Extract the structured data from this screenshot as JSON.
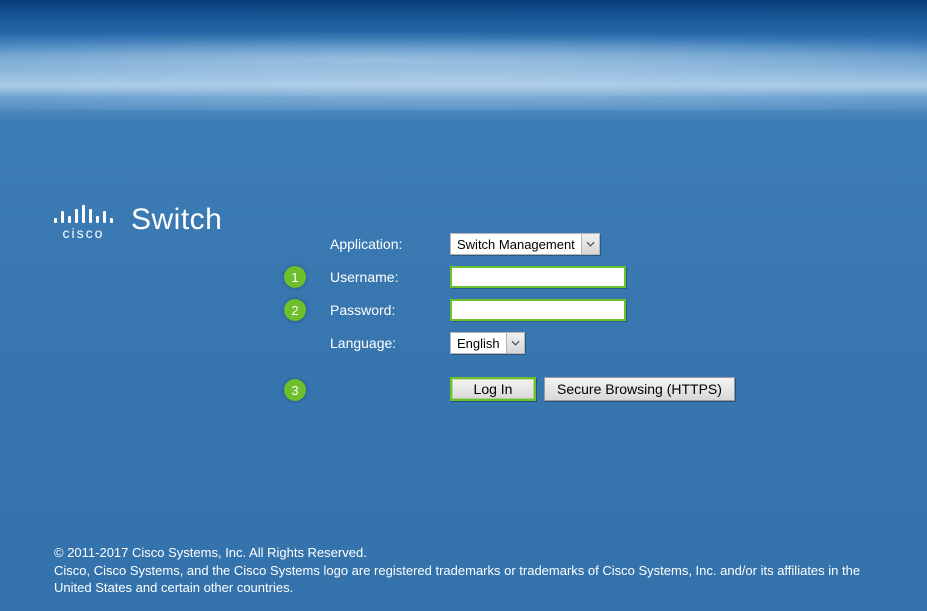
{
  "brand": "cisco",
  "title": "Switch",
  "form": {
    "application_label": "Application:",
    "application_value": "Switch Management",
    "username_label": "Username:",
    "username_value": "",
    "password_label": "Password:",
    "password_value": "",
    "language_label": "Language:",
    "language_value": "English"
  },
  "buttons": {
    "login": "Log In",
    "secure": "Secure Browsing (HTTPS)"
  },
  "steps": {
    "s1": "1",
    "s2": "2",
    "s3": "3"
  },
  "footer": {
    "line1": "© 2011-2017 Cisco Systems, Inc. All Rights Reserved.",
    "line2": "Cisco, Cisco Systems, and the Cisco Systems logo are registered trademarks or trademarks of Cisco Systems, Inc. and/or its affiliates in the United States and certain other countries."
  }
}
